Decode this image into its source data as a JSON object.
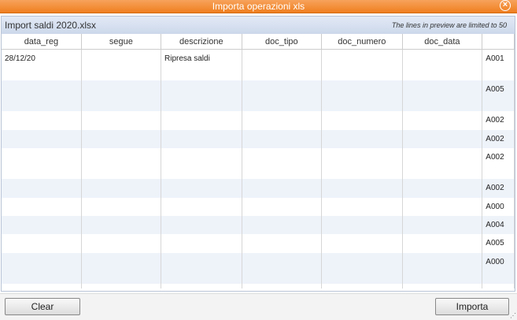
{
  "window": {
    "title": "Importa operazioni xls",
    "close_icon": "close-icon"
  },
  "panel": {
    "title": "Import saldi 2020.xlsx",
    "note": "The lines in preview are limited to 50"
  },
  "table": {
    "columns": [
      "data_reg",
      "segue",
      "descrizione",
      "doc_tipo",
      "doc_numero",
      "doc_data",
      ""
    ],
    "rows": [
      [
        "28/12/20",
        "",
        "Ripresa saldi",
        "",
        "",
        "",
        "A001"
      ],
      [
        "",
        "",
        "",
        "",
        "",
        "",
        "A005"
      ],
      [
        "",
        "",
        "",
        "",
        "",
        "",
        "A002"
      ],
      [
        "",
        "",
        "",
        "",
        "",
        "",
        "A002"
      ],
      [
        "",
        "",
        "",
        "",
        "",
        "",
        "A002"
      ],
      [
        "",
        "",
        "",
        "",
        "",
        "",
        "A002"
      ],
      [
        "",
        "",
        "",
        "",
        "",
        "",
        "A000"
      ],
      [
        "",
        "",
        "",
        "",
        "",
        "",
        "A004"
      ],
      [
        "",
        "",
        "",
        "",
        "",
        "",
        "A005"
      ],
      [
        "",
        "",
        "",
        "",
        "",
        "",
        "A000"
      ],
      [
        "",
        "",
        "",
        "",
        "",
        "",
        ""
      ]
    ]
  },
  "footer": {
    "clear_label": "Clear",
    "import_label": "Importa"
  },
  "colors": {
    "accent": "#ef7f1f",
    "header_bg": "#cbd7ea",
    "row_alt": "#eef3fa"
  }
}
